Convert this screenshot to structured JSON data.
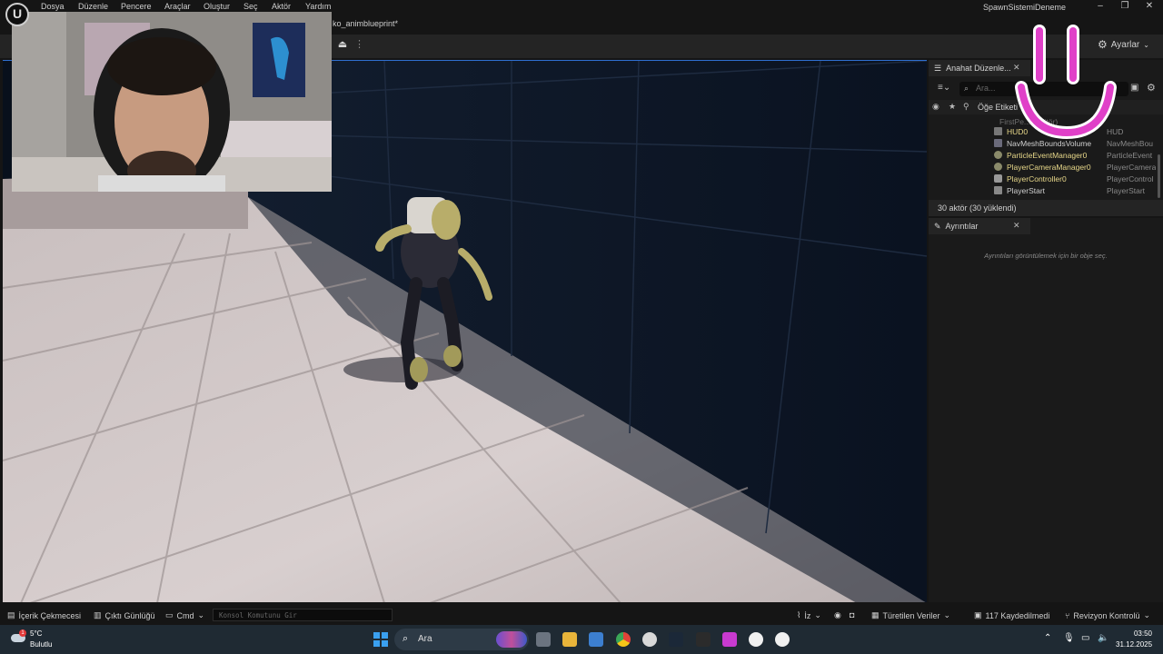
{
  "menu": {
    "items": [
      "Dosya",
      "Düzenle",
      "Pencere",
      "Araçlar",
      "Oluştur",
      "Seç",
      "Aktör",
      "Yardım"
    ],
    "window_title": "SpawnSistemiDeneme"
  },
  "tabs": {
    "document": "ko_animblueprint*"
  },
  "toolbar": {
    "settings_label": "Ayarlar"
  },
  "outliner": {
    "tab_label": "Anahat Düzenle...",
    "search_placeholder": "Ara...",
    "column_label": "Öğe Etiketi",
    "partial_row": "FirstPe... (Editör)",
    "rows": [
      {
        "name": "HUD0",
        "type": "HUD"
      },
      {
        "name": "NavMeshBoundsVolume",
        "type": "NavMeshBou"
      },
      {
        "name": "ParticleEventManager0",
        "type": "ParticleEvent"
      },
      {
        "name": "PlayerCameraManager0",
        "type": "PlayerCamera"
      },
      {
        "name": "PlayerController0",
        "type": "PlayerControl"
      },
      {
        "name": "PlayerStart",
        "type": "PlayerStart"
      }
    ],
    "actor_count": "30 aktör (30 yüklendi)"
  },
  "details": {
    "tab_label": "Ayrıntılar",
    "empty_message": "Ayrıntıları görüntülemek için bir obje seç."
  },
  "statusbar": {
    "content_drawer": "İçerik Çekmecesi",
    "output_log": "Çıktı Günlüğü",
    "cmd": "Cmd",
    "console_placeholder": "Konsol Komutunu Gir",
    "trace": "İz",
    "derived_data": "Türetilen Veriler",
    "unsaved": "117 Kaydedilmedi",
    "revision": "Revizyon Kontrolü"
  },
  "taskbar": {
    "weather_temp": "5°C",
    "weather_cond": "Bulutlu",
    "weather_alert": "1",
    "search_label": "Ara",
    "time": "03:50",
    "date": "31.12.2025"
  },
  "colors": {
    "accent_blue": "#2f6fd0",
    "outliner_item": "#e8d88a",
    "smiley_pink": "#e040c8"
  }
}
